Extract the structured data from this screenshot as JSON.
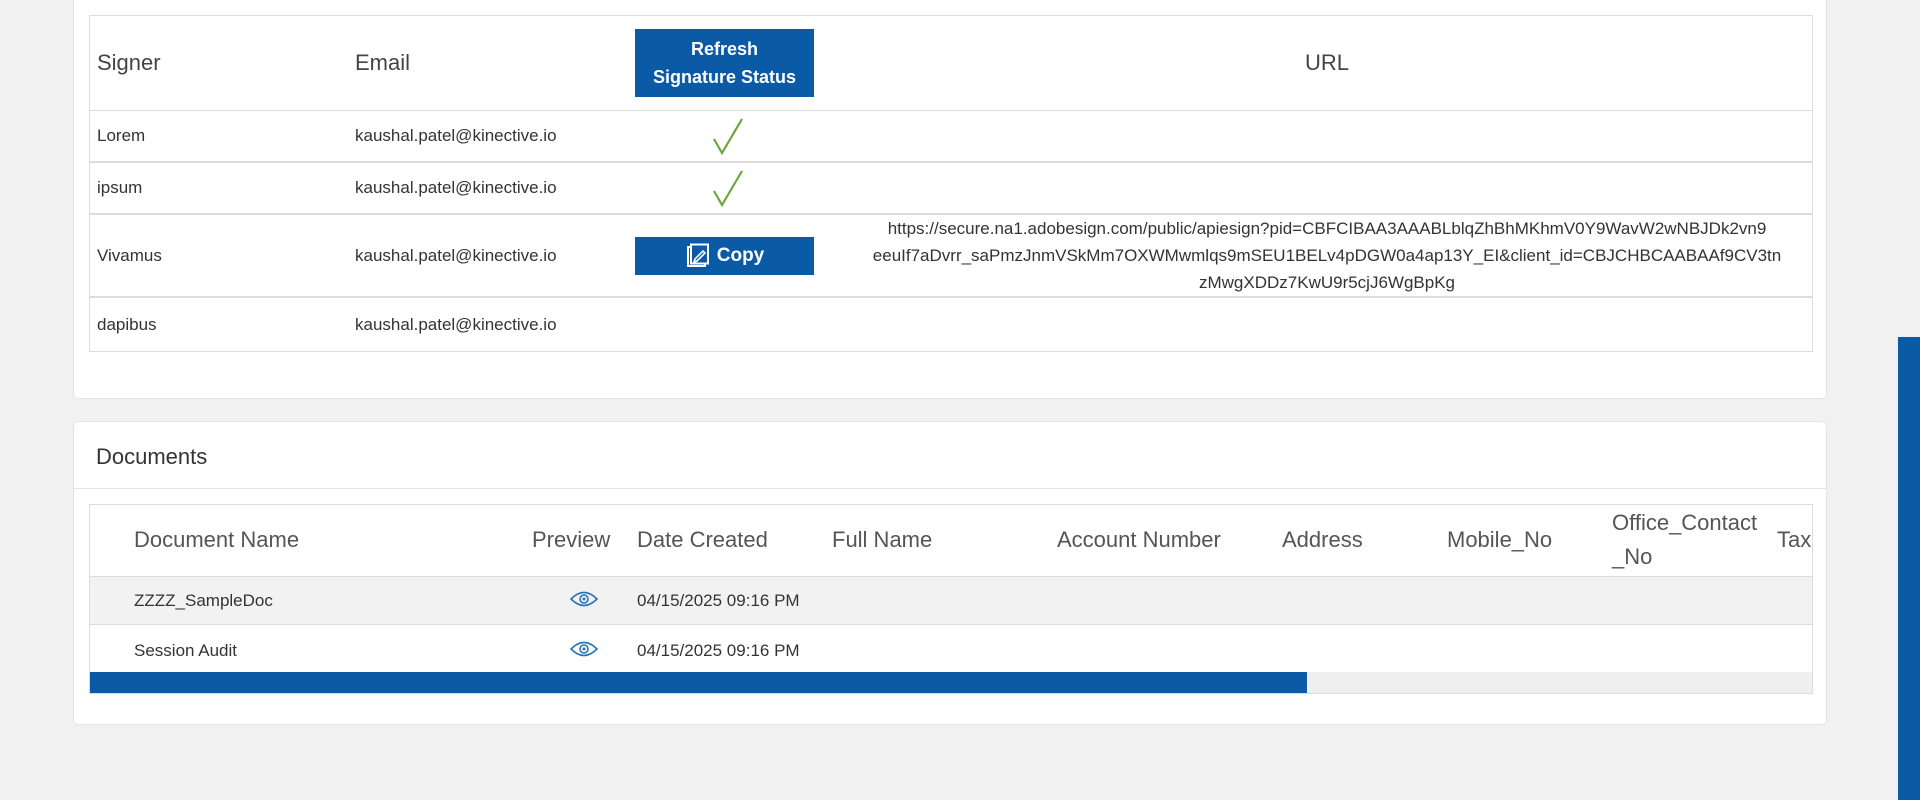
{
  "signers": {
    "headers": {
      "signer": "Signer",
      "email": "Email",
      "refresh_line1": "Refresh",
      "refresh_line2": "Signature Status",
      "url": "URL"
    },
    "rows": [
      {
        "signer": "Lorem",
        "email": "kaushal.patel@kinective.io",
        "status": "signed",
        "url": ""
      },
      {
        "signer": "ipsum",
        "email": "kaushal.patel@kinective.io",
        "status": "signed",
        "url": ""
      },
      {
        "signer": "Vivamus",
        "email": "kaushal.patel@kinective.io",
        "status": "copy",
        "copy_label": "Copy",
        "url_line1": "https://secure.na1.adobesign.com/public/apiesign?pid=CBFCIBAA3AAABLblqZhBhMKhmV0Y9WavW2wNBJDk2vn9",
        "url_line2": "eeuIf7aDvrr_saPmzJnmVSkMm7OXWMwmlqs9mSEU1BELv4pDGW0a4ap13Y_EI&client_id=CBJCHBCAABAAf9CV3tn",
        "url_line3": "zMwgXDDz7KwU9r5cjJ6WgBpKg"
      },
      {
        "signer": "dapibus",
        "email": "kaushal.patel@kinective.io",
        "status": "",
        "url": ""
      }
    ]
  },
  "documents": {
    "title": "Documents",
    "columns": {
      "name": "Document Name",
      "preview": "Preview",
      "date": "Date Created",
      "full_name": "Full Name",
      "account": "Account Number",
      "address": "Address",
      "mobile": "Mobile_No",
      "office1": "Office_Contact",
      "office2": "_No",
      "tax": "Tax"
    },
    "rows": [
      {
        "name": "ZZZZ_SampleDoc",
        "date": "04/15/2025 09:16 PM"
      },
      {
        "name": "Session Audit",
        "date": "04/15/2025 09:16 PM"
      }
    ],
    "scroll_position": 0.706
  },
  "colors": {
    "accent": "#0b5aa5",
    "check": "#6aa83c"
  },
  "icons": [
    "check-icon",
    "edit-copy-icon",
    "eye-icon"
  ]
}
